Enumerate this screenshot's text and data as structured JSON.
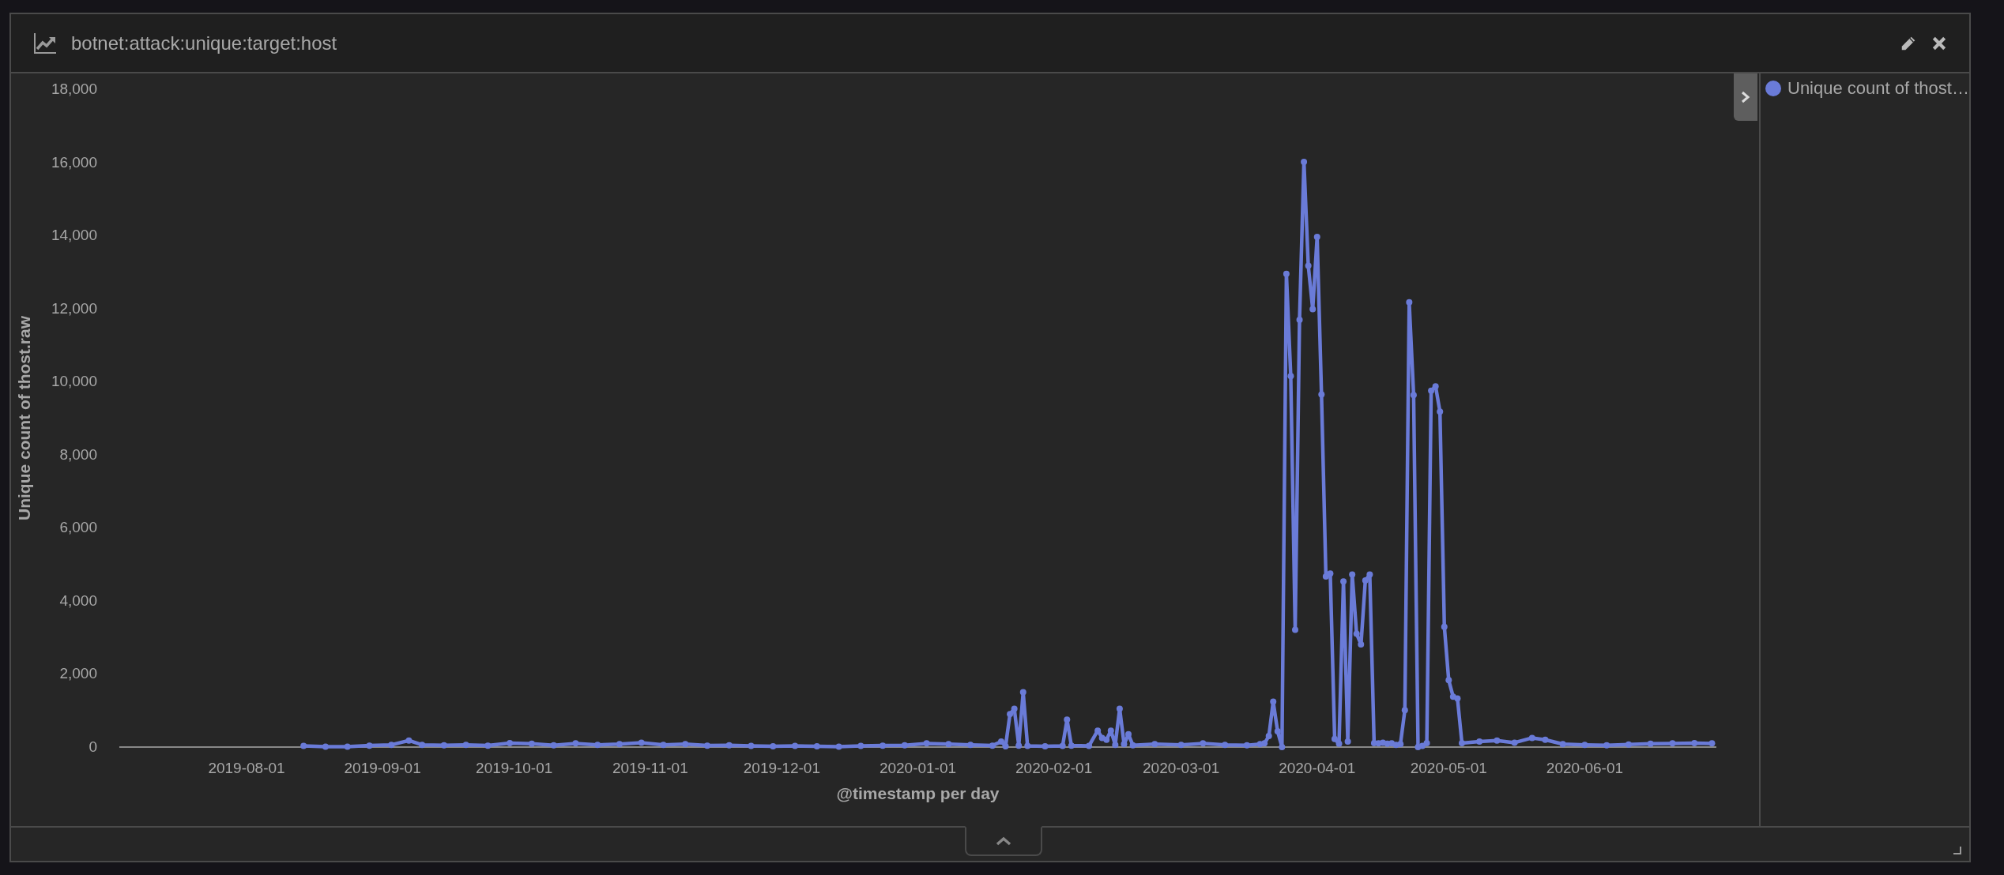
{
  "panel": {
    "title": "botnet:attack:unique:target:host"
  },
  "chart_data": {
    "type": "line",
    "xlabel": "@timestamp per day",
    "ylabel": "Unique count of thost.raw",
    "xlim": [
      "2019-07-03",
      "2020-07-01"
    ],
    "ylim": [
      0,
      18000
    ],
    "yticks": [
      {
        "value": 0,
        "label": "0"
      },
      {
        "value": 2000,
        "label": "2,000"
      },
      {
        "value": 4000,
        "label": "4,000"
      },
      {
        "value": 6000,
        "label": "6,000"
      },
      {
        "value": 8000,
        "label": "8,000"
      },
      {
        "value": 10000,
        "label": "10,000"
      },
      {
        "value": 12000,
        "label": "12,000"
      },
      {
        "value": 14000,
        "label": "14,000"
      },
      {
        "value": 16000,
        "label": "16,000"
      },
      {
        "value": 18000,
        "label": "18,000"
      }
    ],
    "xticks": [
      {
        "value": "2019-08-01",
        "label": "2019-08-01"
      },
      {
        "value": "2019-09-01",
        "label": "2019-09-01"
      },
      {
        "value": "2019-10-01",
        "label": "2019-10-01"
      },
      {
        "value": "2019-11-01",
        "label": "2019-11-01"
      },
      {
        "value": "2019-12-01",
        "label": "2019-12-01"
      },
      {
        "value": "2020-01-01",
        "label": "2020-01-01"
      },
      {
        "value": "2020-02-01",
        "label": "2020-02-01"
      },
      {
        "value": "2020-03-01",
        "label": "2020-03-01"
      },
      {
        "value": "2020-04-01",
        "label": "2020-04-01"
      },
      {
        "value": "2020-05-01",
        "label": "2020-05-01"
      },
      {
        "value": "2020-06-01",
        "label": "2020-06-01"
      }
    ],
    "x": [
      "2019-08-14",
      "2019-08-19",
      "2019-08-24",
      "2019-08-29",
      "2019-09-03",
      "2019-09-07",
      "2019-09-10",
      "2019-09-15",
      "2019-09-20",
      "2019-09-25",
      "2019-09-30",
      "2019-10-05",
      "2019-10-10",
      "2019-10-15",
      "2019-10-20",
      "2019-10-25",
      "2019-10-30",
      "2019-11-04",
      "2019-11-09",
      "2019-11-14",
      "2019-11-19",
      "2019-11-24",
      "2019-11-29",
      "2019-12-04",
      "2019-12-09",
      "2019-12-14",
      "2019-12-19",
      "2019-12-24",
      "2019-12-29",
      "2020-01-03",
      "2020-01-08",
      "2020-01-13",
      "2020-01-18",
      "2020-01-20",
      "2020-01-21",
      "2020-01-22",
      "2020-01-23",
      "2020-01-24",
      "2020-01-25",
      "2020-01-26",
      "2020-01-30",
      "2020-02-03",
      "2020-02-04",
      "2020-02-05",
      "2020-02-09",
      "2020-02-11",
      "2020-02-12",
      "2020-02-13",
      "2020-02-14",
      "2020-02-15",
      "2020-02-16",
      "2020-02-17",
      "2020-02-18",
      "2020-02-19",
      "2020-02-24",
      "2020-03-01",
      "2020-03-06",
      "2020-03-11",
      "2020-03-16",
      "2020-03-19",
      "2020-03-20",
      "2020-03-21",
      "2020-03-22",
      "2020-03-23",
      "2020-03-24",
      "2020-03-25",
      "2020-03-26",
      "2020-03-27",
      "2020-03-28",
      "2020-03-29",
      "2020-03-30",
      "2020-03-31",
      "2020-04-01",
      "2020-04-02",
      "2020-04-03",
      "2020-04-04",
      "2020-04-05",
      "2020-04-06",
      "2020-04-07",
      "2020-04-08",
      "2020-04-09",
      "2020-04-10",
      "2020-04-11",
      "2020-04-12",
      "2020-04-13",
      "2020-04-14",
      "2020-04-15",
      "2020-04-16",
      "2020-04-17",
      "2020-04-18",
      "2020-04-19",
      "2020-04-20",
      "2020-04-21",
      "2020-04-22",
      "2020-04-23",
      "2020-04-24",
      "2020-04-25",
      "2020-04-26",
      "2020-04-27",
      "2020-04-28",
      "2020-04-29",
      "2020-04-30",
      "2020-05-01",
      "2020-05-02",
      "2020-05-03",
      "2020-05-04",
      "2020-05-08",
      "2020-05-12",
      "2020-05-16",
      "2020-05-20",
      "2020-05-23",
      "2020-05-27",
      "2020-06-01",
      "2020-06-06",
      "2020-06-11",
      "2020-06-16",
      "2020-06-21",
      "2020-06-26",
      "2020-06-30"
    ],
    "series": [
      {
        "color": "#6a7bd8",
        "marker": true,
        "values": [
          30,
          10,
          10,
          40,
          60,
          180,
          60,
          50,
          60,
          40,
          110,
          90,
          50,
          100,
          60,
          80,
          120,
          60,
          80,
          40,
          50,
          30,
          20,
          30,
          20,
          10,
          30,
          40,
          50,
          100,
          80,
          60,
          40,
          150,
          20,
          900,
          1050,
          40,
          1500,
          30,
          20,
          30,
          750,
          40,
          30,
          450,
          250,
          200,
          450,
          60,
          1050,
          80,
          350,
          50,
          80,
          60,
          100,
          60,
          50,
          80,
          100,
          300,
          1240,
          430,
          0,
          12950,
          10150,
          3210,
          11690,
          16010,
          13170,
          11980,
          13960,
          9650,
          4670,
          4750,
          220,
          90,
          4530,
          150,
          4720,
          3100,
          2810,
          4560,
          4720,
          110,
          100,
          120,
          90,
          100,
          60,
          80,
          1010,
          12170,
          9630,
          0,
          30,
          110,
          9750,
          9870,
          9180,
          3290,
          1830,
          1380,
          1330,
          110,
          150,
          180,
          120,
          250,
          200,
          80,
          60,
          50,
          70,
          90,
          100,
          110,
          100
        ]
      }
    ]
  },
  "legend": {
    "items": [
      {
        "label": "Unique count of thost…"
      }
    ]
  }
}
